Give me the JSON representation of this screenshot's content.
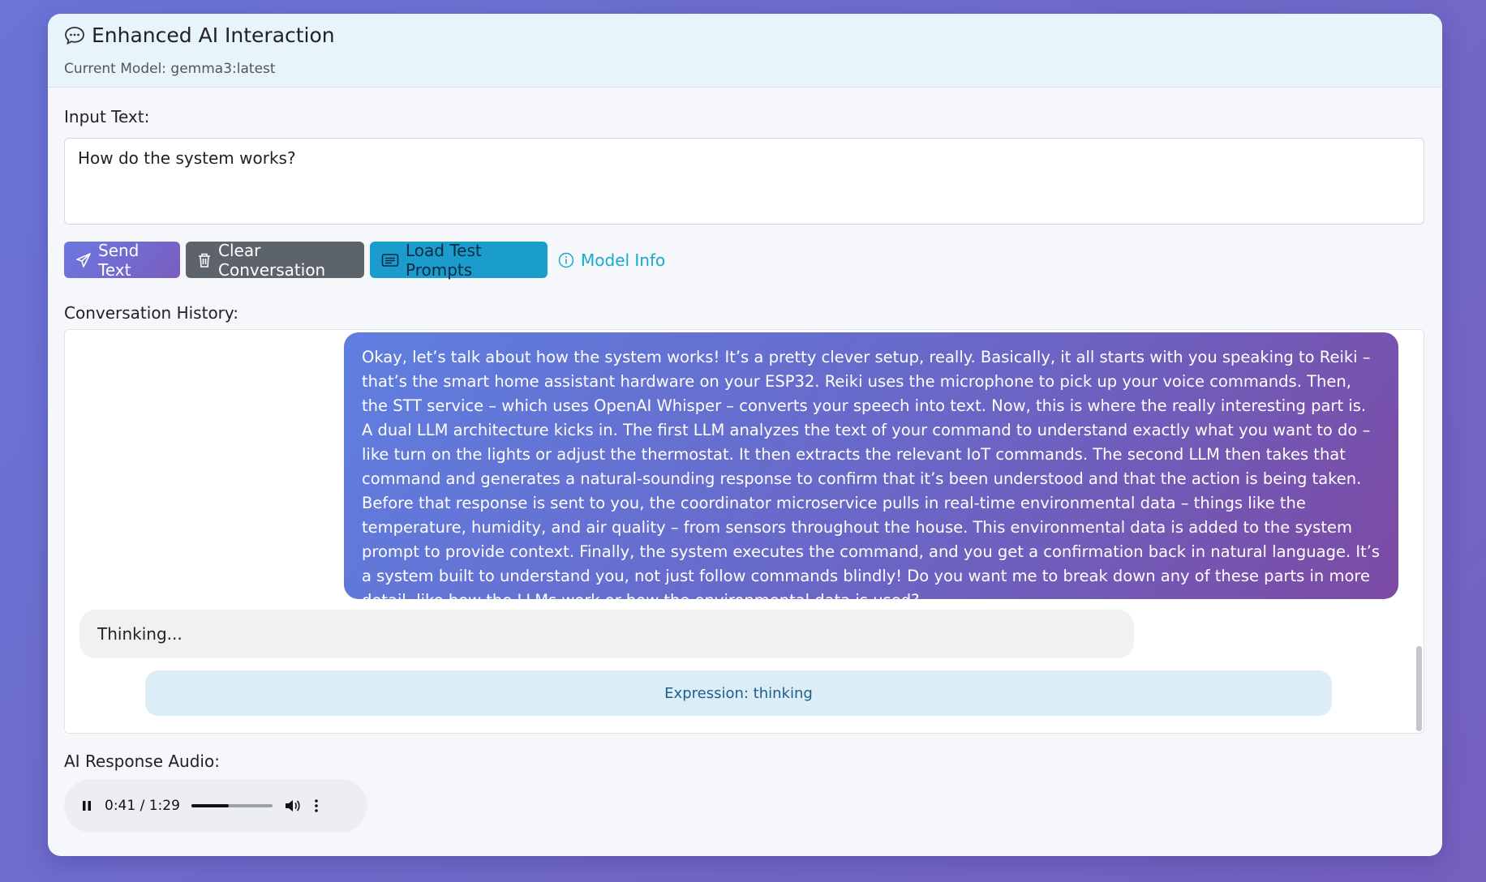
{
  "header": {
    "title": "Enhanced AI Interaction",
    "model_line": "Current Model: gemma3:latest"
  },
  "input": {
    "label": "Input Text:",
    "value": "How do the system works?"
  },
  "buttons": {
    "send": "Send Text",
    "clear": "Clear Conversation",
    "load": "Load Test Prompts",
    "info": "Model Info"
  },
  "history": {
    "label": "Conversation History:",
    "ai_message": "Okay, let’s talk about how the system works! It’s a pretty clever setup, really. Basically, it all starts with you speaking to Reiki – that’s the smart home assistant hardware on your ESP32. Reiki uses the microphone to pick up your voice commands. Then, the STT service – which uses OpenAI Whisper – converts your speech into text. Now, this is where the really interesting part is. A dual LLM architecture kicks in. The first LLM analyzes the text of your command to understand exactly what you want to do – like turn on the lights or adjust the thermostat. It then extracts the relevant IoT commands. The second LLM then takes that command and generates a natural-sounding response to confirm that it’s been understood and that the action is being taken. Before that response is sent to you, the coordinator microservice pulls in real-time environmental data – things like the temperature, humidity, and air quality – from sensors throughout the house. This environmental data is added to the system prompt to provide context. Finally, the system executes the command, and you get a confirmation back in natural language. It’s a system built to understand you, not just follow commands blindly! Do you want me to break down any of these parts in more detail, like how the LLMs work or how the environmental data is used?",
    "thinking": "Thinking...",
    "expression": "Expression: thinking"
  },
  "audio": {
    "label": "AI Response Audio:",
    "time": "0:41 / 1:29",
    "progress": 0.46
  },
  "colors": {
    "accent": "#6b78e0",
    "info": "#17a9cf",
    "load": "#1a9ccd",
    "clear": "#5c636a"
  }
}
